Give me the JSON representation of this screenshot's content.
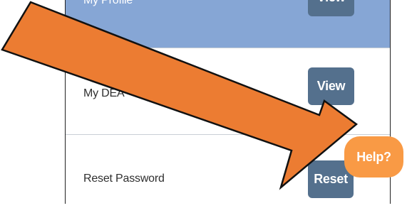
{
  "rows": [
    {
      "label": "My Profile",
      "button": "View"
    },
    {
      "label": "My DEA",
      "button": "View"
    },
    {
      "label": "Reset Password",
      "button": "Reset"
    }
  ],
  "help_button": "Help?",
  "colors": {
    "highlight_row": "#86a6d5",
    "button": "#54708d",
    "help_button": "#f99a45",
    "arrow": "#ec7c32"
  },
  "overlay": {
    "type": "annotation-arrow",
    "icon": "arrow-icon"
  }
}
